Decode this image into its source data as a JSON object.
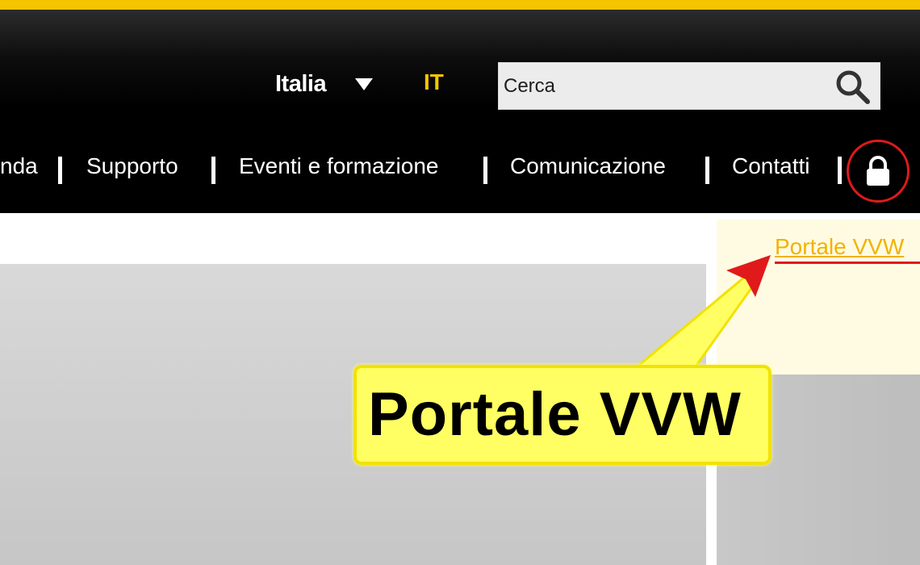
{
  "header": {
    "country": "Italia",
    "language": "IT",
    "search": {
      "placeholder": "Cerca"
    }
  },
  "nav": {
    "items": [
      "nda",
      "Supporto",
      "Eventi e formazione",
      "Comunicazione",
      "Contatti"
    ]
  },
  "dropdown": {
    "link": "Portale VVW"
  },
  "callout": {
    "text": "Portale VVW"
  },
  "colors": {
    "accent": "#f5c400",
    "annotation_red": "#e01a1a",
    "callout_fill": "#ffff63"
  },
  "icons": {
    "search": "search-icon",
    "lock": "lock-icon",
    "country_dropdown": "caret-down-icon"
  }
}
